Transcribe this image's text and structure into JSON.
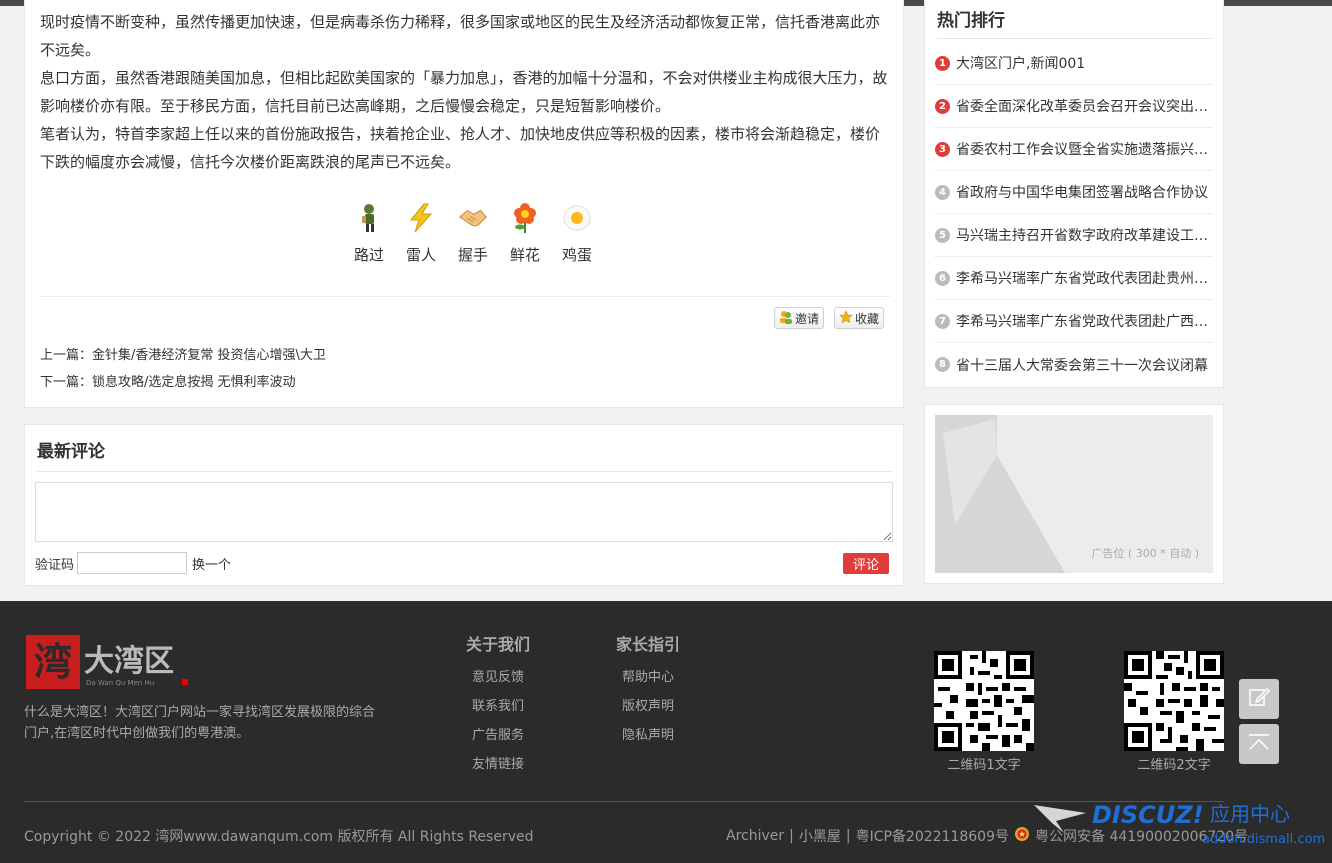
{
  "article": {
    "paragraphs": [
      "现时疫情不断变种，虽然传播更加快速，但是病毒杀伤力稀释，很多国家或地区的民生及经济活动都恢复正常，信托香港离此亦不远矣。",
      "息口方面，虽然香港跟随美国加息，但相比起欧美国家的「暴力加息」，香港的加幅十分温和，不会对供楼业主构成很大压力，故影响楼价亦有限。至于移民方面，信托目前已达高峰期，之后慢慢会稳定，只是短暂影响楼价。",
      "笔者认为，特首李家超上任以来的首份施政报告，挟着抢企业、抢人才、加快地皮供应等积极的因素，楼市将会渐趋稳定，楼价下跌的幅度亦会减慢，信托今次楼价距离跌浪的尾声已不远矣。"
    ],
    "reactions": [
      {
        "label": "路过",
        "icon": "walker-icon"
      },
      {
        "label": "雷人",
        "icon": "lightning-icon"
      },
      {
        "label": "握手",
        "icon": "handshake-icon"
      },
      {
        "label": "鲜花",
        "icon": "flower-icon"
      },
      {
        "label": "鸡蛋",
        "icon": "egg-icon"
      }
    ],
    "invite_label": "邀请",
    "favorite_label": "收藏",
    "prev_prefix": "上一篇：",
    "prev_title": "金针集/香港经济复常 投资信心增强\\大卫",
    "next_prefix": "下一篇：",
    "next_title": "锁息攻略/选定息按揭 无惧利率波动"
  },
  "comments": {
    "title": "最新评论",
    "captcha_label": "验证码",
    "captcha_change": "换一个",
    "submit_label": "评论"
  },
  "hot": {
    "title": "热门排行",
    "items": [
      {
        "rank": "1",
        "text": "大湾区门户,新闻001",
        "color": "#e03c3c"
      },
      {
        "rank": "2",
        "text": "省委全面深化改革委员会召开会议突出重点",
        "color": "#e03c3c"
      },
      {
        "rank": "3",
        "text": "省委农村工作会议暨全省实施遗落振兴战略",
        "color": "#e03c3c"
      },
      {
        "rank": "4",
        "text": "省政府与中国华电集团签署战略合作协议",
        "color": "#bbbbbb"
      },
      {
        "rank": "5",
        "text": "马兴瑞主持召开省数字政府改革建设工作会",
        "color": "#bbbbbb"
      },
      {
        "rank": "6",
        "text": "李希马兴瑞率广东省党政代表团赴贵州考察",
        "color": "#bbbbbb"
      },
      {
        "rank": "7",
        "text": "李希马兴瑞率广东省党政代表团赴广西考察",
        "color": "#bbbbbb"
      },
      {
        "rank": "8",
        "text": "省十三届人大常委会第三十一次会议闭幕",
        "color": "#bbbbbb"
      }
    ]
  },
  "ad": {
    "label": "广告位 ( 300 * 自动 )"
  },
  "footer": {
    "logo_text": "大湾区",
    "logo_sub": "Da Wan Qu Men Hu",
    "about": "什么是大湾区！大湾区门户网站一家寻找湾区发展极限的综合门户,在湾区时代中创做我们的粤港澳。",
    "col1": {
      "heading": "关于我们",
      "links": [
        "意见反馈",
        "联系我们",
        "广告服务",
        "友情链接"
      ]
    },
    "col2": {
      "heading": "家长指引",
      "links": [
        "帮助中心",
        "版权声明",
        "隐私声明"
      ]
    },
    "qr1_label": "二维码1文字",
    "qr2_label": "二维码2文字",
    "copyright": "Copyright © 2022 湾网www.dawanqum.com 版权所有 All Rights Reserved",
    "link_archiver": "Archiver",
    "link_blackroom": "小黑屋",
    "icp": "粤ICP备2022118609号",
    "police": "粤公网安备 44190002006720号",
    "watermark_brand": "DISCUZ!",
    "watermark_cn": "应用中心",
    "watermark_url": "addon.dismall.com"
  }
}
